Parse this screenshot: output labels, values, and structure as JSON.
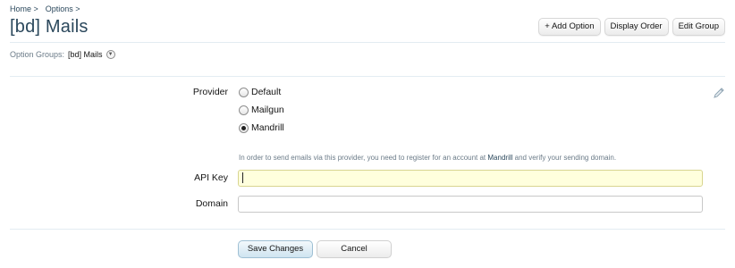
{
  "breadcrumb": [
    "Home >",
    "Options >"
  ],
  "title": "[bd] Mails",
  "actions": {
    "add_option": "+ Add Option",
    "display_order": "Display Order",
    "edit_group": "Edit Group"
  },
  "option_groups": {
    "label": "Option Groups:",
    "current": "[bd] Mails"
  },
  "provider": {
    "label": "Provider",
    "options": [
      "Default",
      "Mailgun",
      "Mandrill"
    ],
    "selected": "Mandrill",
    "hint_before": "In order to send emails via this provider, you need to register for an account at",
    "hint_link": "Mandrill",
    "hint_after": "and verify your sending domain."
  },
  "api_key": {
    "label": "API Key",
    "value": ""
  },
  "domain": {
    "label": "Domain",
    "value": ""
  },
  "buttons": {
    "save": "Save Changes",
    "cancel": "Cancel"
  },
  "colors": {
    "title": "#2b485c",
    "focused_input_bg": "#ffffdd",
    "primary_button": "#cfe4f0"
  }
}
